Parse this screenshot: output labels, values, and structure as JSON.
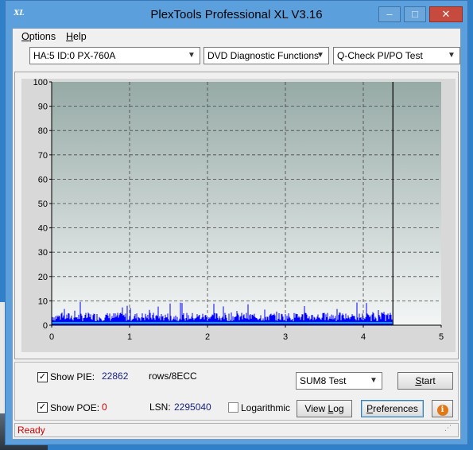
{
  "window": {
    "title": "PlexTools Professional XL V3.16",
    "icon_text": "XL",
    "controls": {
      "minimize": "‒",
      "maximize": "□",
      "close": "✕"
    }
  },
  "menu": [
    {
      "pre": "",
      "accel": "O",
      "post": "ptions"
    },
    {
      "pre": "",
      "accel": "H",
      "post": "elp"
    }
  ],
  "selectors": {
    "drive": "HA:5 ID:0  PX-760A",
    "function": "DVD Diagnostic Functions",
    "test": "Q-Check PI/PO Test"
  },
  "chart_data": {
    "type": "bar",
    "x_ticks": [
      "0",
      "1",
      "2",
      "3",
      "4",
      "5"
    ],
    "y_ticks": [
      "0",
      "10",
      "20",
      "30",
      "40",
      "50",
      "60",
      "70",
      "80",
      "90",
      "100"
    ],
    "xlim": [
      0,
      5
    ],
    "ylim": [
      0,
      100
    ],
    "end_marker_x": 4.38,
    "grid": true,
    "series": [
      {
        "color": "#0000ff",
        "approx_max": 10,
        "approx_typical": 4
      },
      {
        "color": "#00aaff",
        "approx_level": 1
      }
    ],
    "background_top": "#96aaa6",
    "background_bottom": "#f4f6f6"
  },
  "controls": {
    "show_pie": {
      "label_pre": "Show PIE:",
      "checked": true,
      "value": "22862",
      "unit": "rows/8ECC"
    },
    "show_poe": {
      "label_pre": "Show POE:",
      "checked": true,
      "value": "0"
    },
    "lsn": {
      "label": "LSN:",
      "value": "2295040"
    },
    "logarithmic": {
      "label": "Logarithmic",
      "checked": false
    },
    "test_select": "SUM8 Test",
    "start": {
      "accel": "S",
      "rest": "tart"
    },
    "view_log": {
      "pre": "View ",
      "accel": "L",
      "post": "og"
    },
    "preferences": {
      "pre": "",
      "accel": "P",
      "post": "references"
    },
    "info_icon": "i"
  },
  "status": "Ready"
}
